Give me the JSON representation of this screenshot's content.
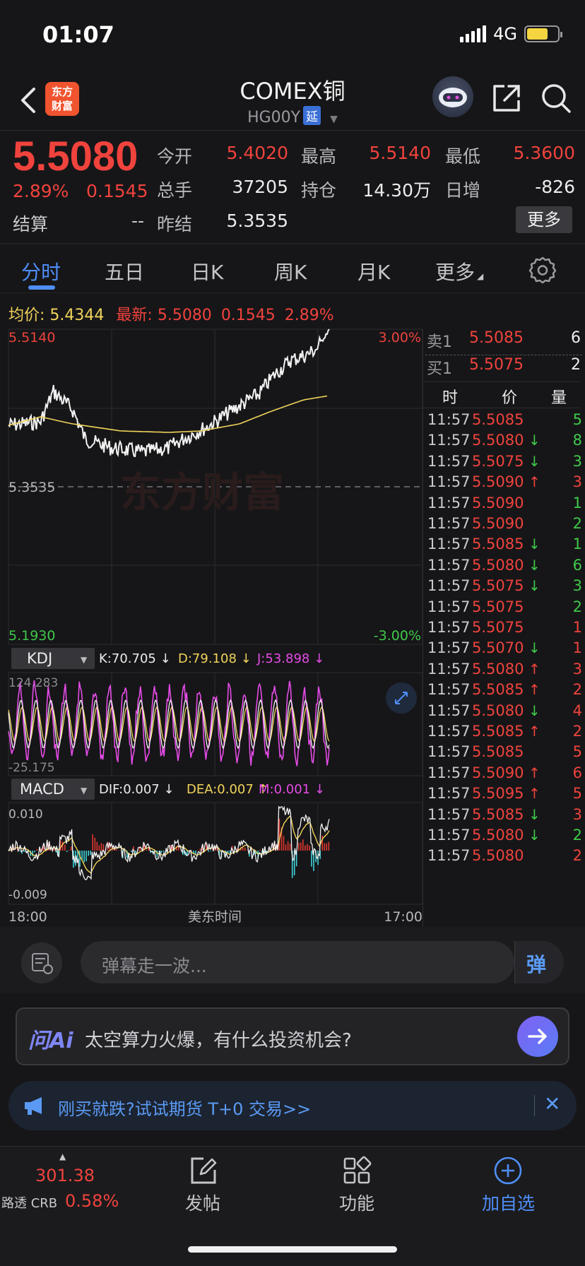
{
  "status": {
    "time": "01:07",
    "network": "4G"
  },
  "header": {
    "logo_text_1": "东方",
    "logo_text_2": "财富",
    "title": "COMEX铜",
    "code": "HG00Y",
    "delay_tag": "延"
  },
  "quote": {
    "price": "5.5080",
    "change_pct": "2.89%",
    "change_abs": "0.1545",
    "settle_label": "结算",
    "settle_value": "--",
    "open_label": "今开",
    "open_value": "5.4020",
    "high_label": "最高",
    "high_value": "5.5140",
    "low_label": "最低",
    "low_value": "5.3600",
    "volume_label": "总手",
    "volume_value": "37205",
    "oi_label": "持仓",
    "oi_value": "14.30万",
    "daily_inc_label": "日增",
    "daily_inc_value": "-826",
    "prev_settle_label": "昨结",
    "prev_settle_value": "5.3535",
    "more_button": "更多"
  },
  "tabs": [
    "分时",
    "五日",
    "日K",
    "周K",
    "月K",
    "更多"
  ],
  "avg_bar": {
    "avg_label": "均价:",
    "avg_value": "5.4344",
    "latest_label": "最新:",
    "latest_price": "5.5080",
    "latest_change": "0.1545",
    "latest_pct": "2.89%"
  },
  "chart_labels": {
    "top_price": "5.5140",
    "top_pct": "3.00%",
    "mid_price": "5.3535",
    "bottom_price": "5.1930",
    "bottom_pct": "-3.00%",
    "watermark": "东方财富",
    "kdj_name": "KDJ",
    "kdj_k": "K:70.705 ↓",
    "kdj_d": "D:79.108 ↓",
    "kdj_j": "J:53.898 ↓",
    "kdj_max": "124.283",
    "kdj_min": "-25.175",
    "macd_name": "MACD",
    "macd_dif": "DIF:0.007 ↓",
    "macd_dea": "DEA:0.007 ↑",
    "macd_m": "M:0.001 ↓",
    "macd_max": "0.010",
    "macd_min": "-0.009",
    "time_start": "18:00",
    "time_mid": "美东时间",
    "time_end": "17:00"
  },
  "colors": {
    "up": "#f0433d",
    "down": "#3fc94a",
    "avg": "#f1d35b",
    "accent": "#4f8ef7"
  },
  "orderbook": {
    "ask_label": "卖1",
    "ask_price": "5.5085",
    "ask_qty": "6",
    "bid_label": "买1",
    "bid_price": "5.5075",
    "bid_qty": "2",
    "col_time": "时",
    "col_price": "价",
    "col_qty": "量"
  },
  "trades": [
    {
      "time": "11:57",
      "price": "5.5085",
      "arrow": "",
      "qty": "5",
      "qty_color": "green"
    },
    {
      "time": "11:57",
      "price": "5.5080",
      "arrow": "↓",
      "qty": "8",
      "qty_color": "green"
    },
    {
      "time": "11:57",
      "price": "5.5075",
      "arrow": "↓",
      "qty": "3",
      "qty_color": "green"
    },
    {
      "time": "11:57",
      "price": "5.5090",
      "arrow": "↑",
      "qty": "3",
      "qty_color": "red"
    },
    {
      "time": "11:57",
      "price": "5.5090",
      "arrow": "",
      "qty": "1",
      "qty_color": "green"
    },
    {
      "time": "11:57",
      "price": "5.5090",
      "arrow": "",
      "qty": "2",
      "qty_color": "green"
    },
    {
      "time": "11:57",
      "price": "5.5085",
      "arrow": "↓",
      "qty": "1",
      "qty_color": "green"
    },
    {
      "time": "11:57",
      "price": "5.5080",
      "arrow": "↓",
      "qty": "6",
      "qty_color": "green"
    },
    {
      "time": "11:57",
      "price": "5.5075",
      "arrow": "↓",
      "qty": "3",
      "qty_color": "green"
    },
    {
      "time": "11:57",
      "price": "5.5075",
      "arrow": "",
      "qty": "2",
      "qty_color": "green"
    },
    {
      "time": "11:57",
      "price": "5.5075",
      "arrow": "",
      "qty": "1",
      "qty_color": "red"
    },
    {
      "time": "11:57",
      "price": "5.5070",
      "arrow": "↓",
      "qty": "1",
      "qty_color": "red"
    },
    {
      "time": "11:57",
      "price": "5.5080",
      "arrow": "↑",
      "qty": "3",
      "qty_color": "red"
    },
    {
      "time": "11:57",
      "price": "5.5085",
      "arrow": "↑",
      "qty": "2",
      "qty_color": "red"
    },
    {
      "time": "11:57",
      "price": "5.5080",
      "arrow": "↓",
      "qty": "4",
      "qty_color": "red"
    },
    {
      "time": "11:57",
      "price": "5.5085",
      "arrow": "↑",
      "qty": "2",
      "qty_color": "red"
    },
    {
      "time": "11:57",
      "price": "5.5085",
      "arrow": "",
      "qty": "5",
      "qty_color": "red"
    },
    {
      "time": "11:57",
      "price": "5.5090",
      "arrow": "↑",
      "qty": "6",
      "qty_color": "red"
    },
    {
      "time": "11:57",
      "price": "5.5095",
      "arrow": "↑",
      "qty": "5",
      "qty_color": "red"
    },
    {
      "time": "11:57",
      "price": "5.5085",
      "arrow": "↓",
      "qty": "3",
      "qty_color": "red"
    },
    {
      "time": "11:57",
      "price": "5.5080",
      "arrow": "↓",
      "qty": "2",
      "qty_color": "green"
    },
    {
      "time": "11:57",
      "price": "5.5080",
      "arrow": "",
      "qty": "2",
      "qty_color": "red"
    }
  ],
  "danmaku": {
    "placeholder": "弹幕走一波..."
  },
  "ai_ask": {
    "logo": "问Ai",
    "prompt": "太空算力火爆，有什么投资机会?"
  },
  "promo": {
    "text": "刚买就跌?试试期货 T+0 交易>>"
  },
  "bottom_bar": {
    "crb_value": "301.38",
    "crb_label": "路透 CRB",
    "crb_pct": "0.58%",
    "post_label": "发帖",
    "func_label": "功能",
    "add_label": "加自选"
  }
}
